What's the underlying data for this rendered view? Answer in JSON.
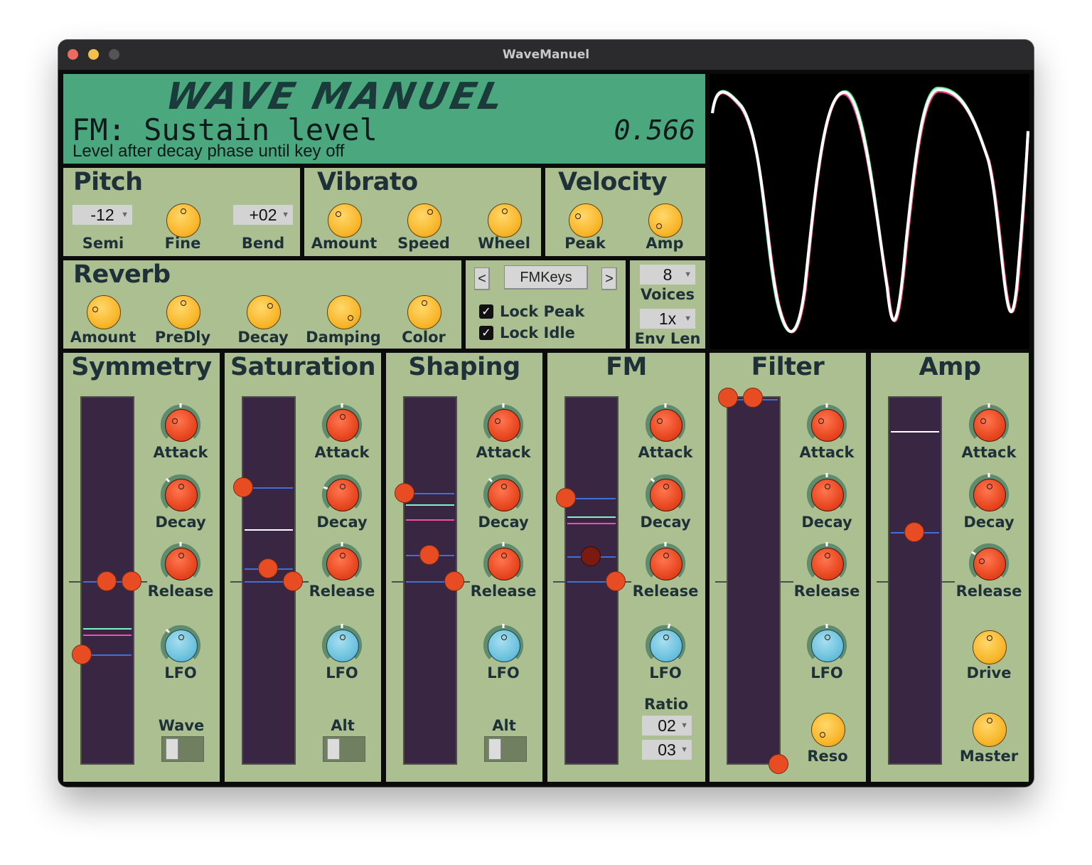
{
  "window": {
    "title": "WaveManuel"
  },
  "header": {
    "logo": "WAVE MANUEL",
    "param_name": "FM: Sustain level",
    "param_value": "0.566",
    "param_desc": "Level after decay phase until key off"
  },
  "colors": {
    "header_bg": "#4aa77e",
    "panel_bg": "#acbf90",
    "mod_bg": "#392643",
    "knob_main": "#f8b62b",
    "knob_env": "#e7461f",
    "knob_lfo": "#6cc2de",
    "handle": "#e84c22"
  },
  "pitch": {
    "title": "Pitch",
    "semi_value": "-12",
    "semi_label": "Semi",
    "fine_label": "Fine",
    "bend_value": "+02",
    "bend_label": "Bend"
  },
  "vibrato": {
    "title": "Vibrato",
    "amount_label": "Amount",
    "speed_label": "Speed",
    "wheel_label": "Wheel"
  },
  "velocity": {
    "title": "Velocity",
    "peak_label": "Peak",
    "amp_label": "Amp"
  },
  "reverb": {
    "title": "Reverb",
    "amount_label": "Amount",
    "predly_label": "PreDly",
    "decay_label": "Decay",
    "damping_label": "Damping",
    "color_label": "Color"
  },
  "preset": {
    "prev": "<",
    "name": "FMKeys",
    "next": ">",
    "lock_peak": "Lock Peak",
    "lock_idle": "Lock Idle",
    "lock_peak_checked": true,
    "lock_idle_checked": true
  },
  "voices": {
    "value": "8",
    "label": "Voices",
    "env_value": "1x",
    "env_label": "Env Len"
  },
  "modules": {
    "symmetry": {
      "title": "Symmetry",
      "attack": "Attack",
      "decay": "Decay",
      "release": "Release",
      "lfo": "LFO",
      "toggle_label": "Wave"
    },
    "saturation": {
      "title": "Saturation",
      "attack": "Attack",
      "decay": "Decay",
      "release": "Release",
      "lfo": "LFO",
      "toggle_label": "Alt"
    },
    "shaping": {
      "title": "Shaping",
      "attack": "Attack",
      "decay": "Decay",
      "release": "Release",
      "lfo": "LFO",
      "toggle_label": "Alt"
    },
    "fm": {
      "title": "FM",
      "attack": "Attack",
      "decay": "Decay",
      "release": "Release",
      "lfo": "LFO",
      "ratio_label": "Ratio",
      "ratio_a": "02",
      "ratio_b": "03"
    },
    "filter": {
      "title": "Filter",
      "attack": "Attack",
      "decay": "Decay",
      "release": "Release",
      "lfo": "LFO",
      "reso_label": "Reso"
    },
    "amp": {
      "title": "Amp",
      "attack": "Attack",
      "decay": "Decay",
      "release": "Release",
      "drive_label": "Drive",
      "master_label": "Master"
    }
  }
}
